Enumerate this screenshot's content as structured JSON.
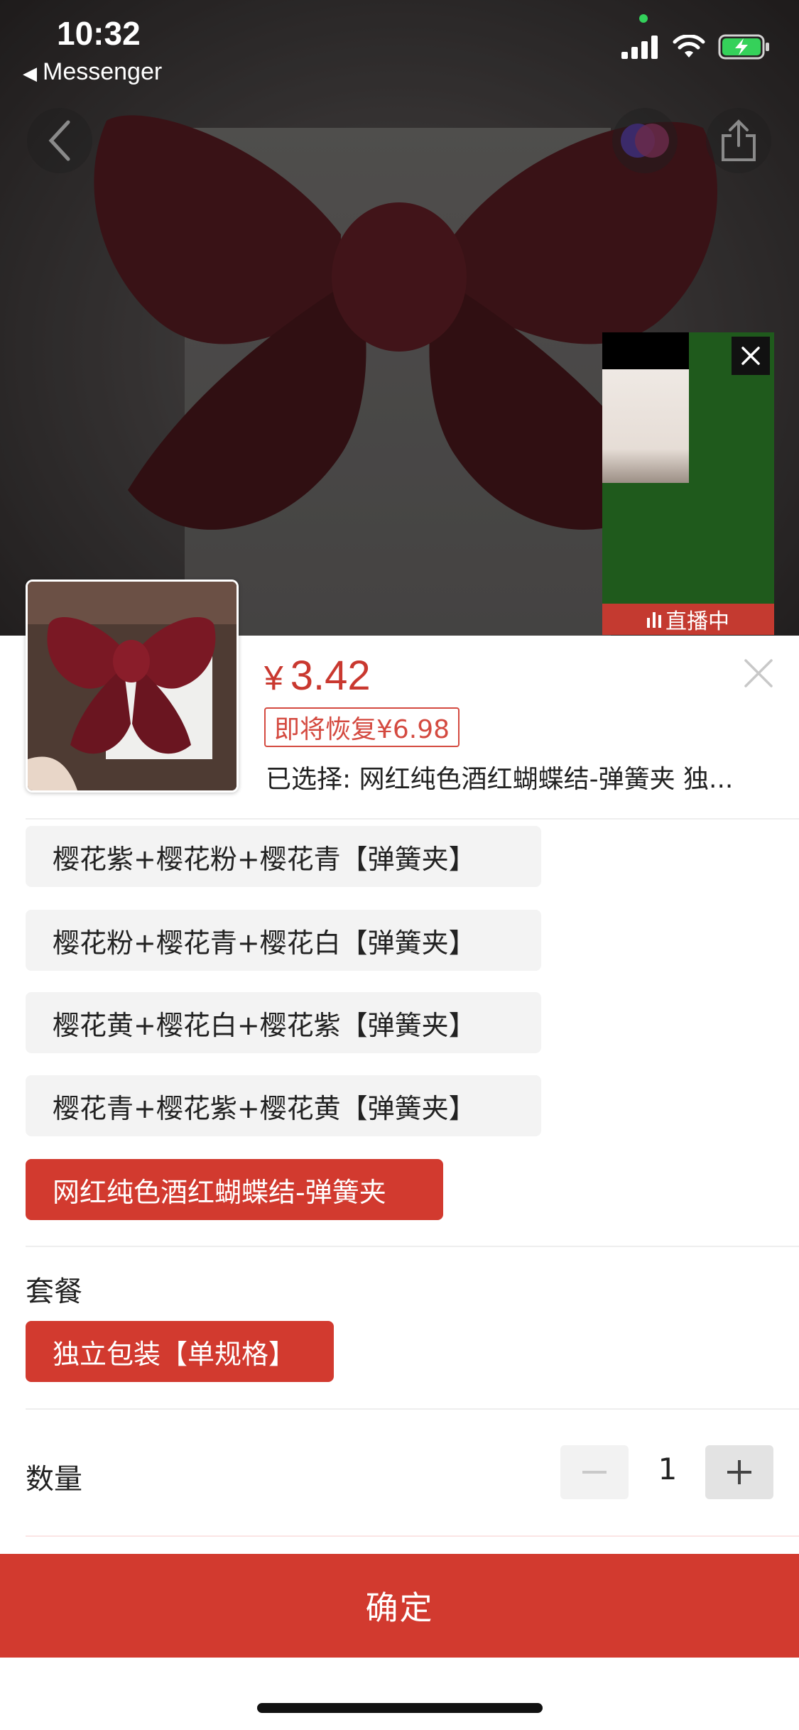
{
  "status_bar": {
    "time": "10:32",
    "back_app": "Messenger",
    "icons": [
      "signal-icon",
      "wifi-icon",
      "battery-charging-icon"
    ]
  },
  "hero": {
    "buttons": [
      "back-icon",
      "avatar-icon",
      "share-icon"
    ]
  },
  "live_window": {
    "tag": "直播中"
  },
  "product": {
    "price_symbol": "¥",
    "price": "3.42",
    "restore_label": "即将恢复¥6.98",
    "selected_label": "已选择: 网红纯色酒红蝴蝶结-弹簧夹 独..."
  },
  "styles": [
    {
      "label": "樱花紫+樱花粉+樱花青【弹簧夹】",
      "selected": false
    },
    {
      "label": "樱花粉+樱花青+樱花白【弹簧夹】",
      "selected": false
    },
    {
      "label": "樱花黄+樱花白+樱花紫【弹簧夹】",
      "selected": false
    },
    {
      "label": "樱花青+樱花紫+樱花黄【弹簧夹】",
      "selected": false
    },
    {
      "label": "网红纯色酒红蝴蝶结-弹簧夹",
      "selected": true
    }
  ],
  "package": {
    "title": "套餐",
    "options": [
      {
        "label": "独立包装【单规格】",
        "selected": true
      }
    ]
  },
  "quantity": {
    "title": "数量",
    "value": "1"
  },
  "confirm_label": "确定",
  "colors": {
    "accent": "#d23a2f",
    "live_green": "#1f5a1c"
  }
}
